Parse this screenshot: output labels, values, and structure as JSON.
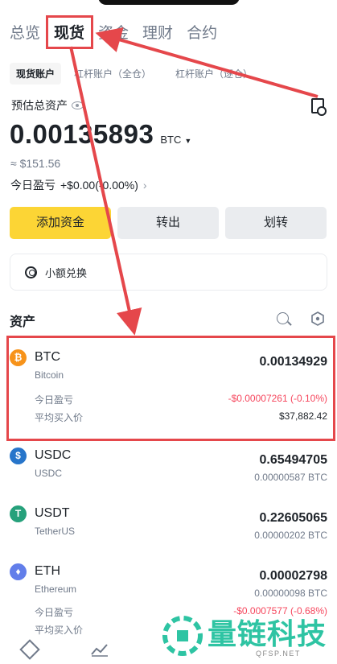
{
  "tabs": [
    "总览",
    "现货",
    "资金",
    "理财",
    "合约"
  ],
  "subtabs": [
    "现货账户",
    "杠杆账户（全仓）",
    "杠杆账户（逐仓）"
  ],
  "estimate_label": "预估总资产",
  "balance": {
    "value": "0.00135893",
    "unit": "BTC",
    "caret": "▼",
    "usd": "≈ $151.56"
  },
  "today_pnl": {
    "label": "今日盈亏",
    "value": "+$0.00(-0.00%)",
    "chevron": "›"
  },
  "actions": {
    "deposit": "添加资金",
    "withdraw": "转出",
    "transfer": "划转"
  },
  "small_convert": "小额兑换",
  "assets_title": "资产",
  "assets": [
    {
      "symbol": "BTC",
      "name": "Bitcoin",
      "amount": "0.00134929",
      "btc_value": "",
      "color": "#f7931a",
      "glyph": "₿",
      "pnl_label": "今日盈亏",
      "pnl": "-$0.00007261 (-0.10%)",
      "avg_label": "平均买入价",
      "avg": "$37,882.42"
    },
    {
      "symbol": "USDC",
      "name": "USDC",
      "amount": "0.65494705",
      "btc_value": "0.00000587 BTC",
      "color": "#2775ca",
      "glyph": "$"
    },
    {
      "symbol": "USDT",
      "name": "TetherUS",
      "amount": "0.22605065",
      "btc_value": "0.00000202 BTC",
      "color": "#26a17b",
      "glyph": "T"
    },
    {
      "symbol": "ETH",
      "name": "Ethereum",
      "amount": "0.00002798",
      "btc_value": "0.00000098 BTC",
      "color": "#627eea",
      "glyph": "♦",
      "pnl_label": "今日盈亏",
      "pnl": "-$0.0007577 (-0.68%)",
      "avg_label": "平均买入价",
      "avg": ""
    }
  ],
  "watermark": {
    "text": "量链科技",
    "sub": "QFSP.NET"
  },
  "colors": {
    "accent": "#fcd535",
    "annotation": "#e5474b",
    "negative": "#f6465d",
    "watermark": "#2ec4a3"
  }
}
